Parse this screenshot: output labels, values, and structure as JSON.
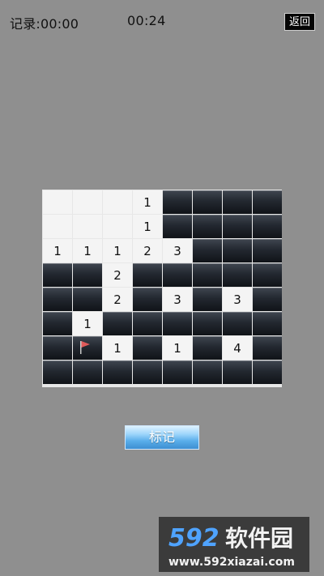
{
  "header": {
    "record_label": "记录:00:00",
    "timer": "00:24",
    "back_label": "返回"
  },
  "board": {
    "rows": [
      [
        "",
        "",
        "",
        "1",
        "#",
        "#",
        "#",
        "#"
      ],
      [
        "",
        "",
        "",
        "1",
        "#",
        "#",
        "#",
        "#"
      ],
      [
        "1",
        "1",
        "1",
        "2",
        "3",
        "#",
        "#",
        "#"
      ],
      [
        "#",
        "#",
        "2",
        "#",
        "#",
        "#",
        "#",
        "#"
      ],
      [
        "#",
        "#",
        "2",
        "#",
        "3",
        "#",
        "3",
        "#"
      ],
      [
        "#",
        "1",
        "#",
        "#",
        "#",
        "#",
        "#",
        "#"
      ],
      [
        "#",
        "F",
        "1",
        "#",
        "1",
        "#",
        "4",
        "#"
      ],
      [
        "#",
        "#",
        "#",
        "#",
        "#",
        "#",
        "#",
        "#"
      ]
    ]
  },
  "mark_button": {
    "label": "标记"
  },
  "watermark": {
    "text": "592软件园",
    "url_text": "www.592xiazai.com"
  },
  "colors": {
    "background": "#8f8f8f",
    "flag": "#e05a5a",
    "button": "#5aaeea"
  }
}
